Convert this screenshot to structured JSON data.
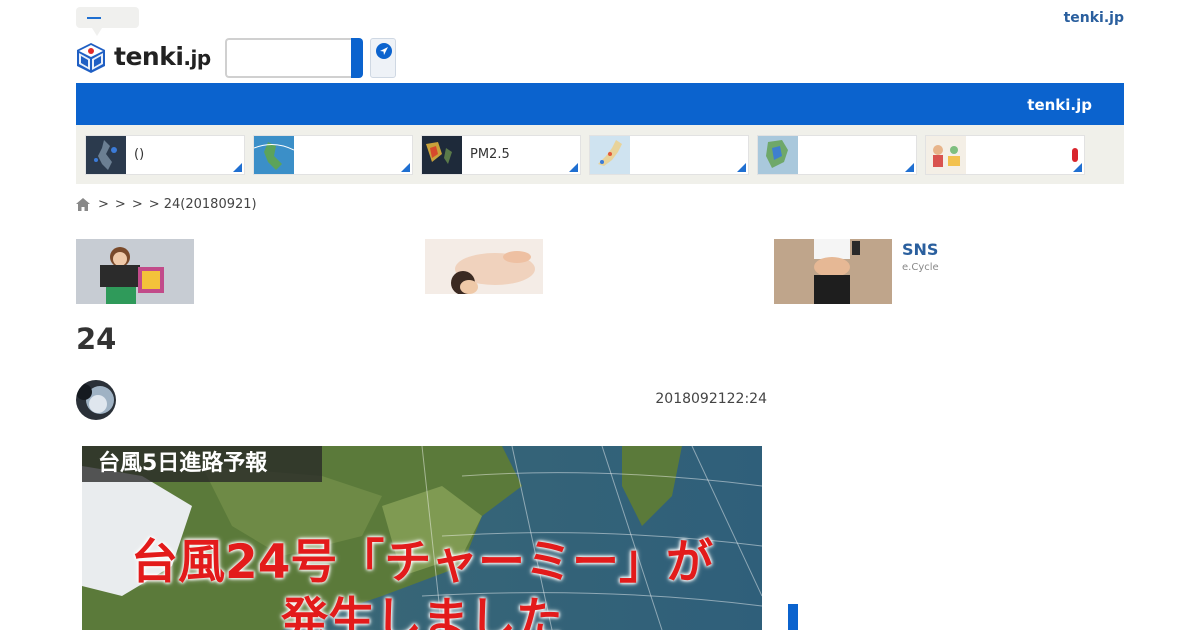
{
  "header": {
    "top_link": "tenki.jp",
    "logo_text": "tenki",
    "logo_tld": ".jp",
    "search": {
      "value": "",
      "placeholder": ""
    }
  },
  "navbar": {
    "label": "tenki.jp"
  },
  "tiles": [
    {
      "label": "()"
    },
    {
      "label": ""
    },
    {
      "label": "PM2.5"
    },
    {
      "label": ""
    },
    {
      "label": ""
    },
    {
      "label": ""
    }
  ],
  "breadcrumb": {
    "items": [
      ">",
      ">",
      ">",
      "> 24(20180921)"
    ]
  },
  "promo": {
    "sns_title": "SNS",
    "sns_source": "e.Cycle"
  },
  "article": {
    "title": "24",
    "timestamp": "2018092122:24",
    "hero_label": "台風5日進路予報",
    "hero_headline_1": "台風24号「チャーミー」が",
    "hero_headline_2": "発生しました"
  },
  "colors": {
    "brand_blue": "#0b63ce",
    "link_blue": "#2a5f9e",
    "alert_red": "#d9252d",
    "headline_red": "#e31b1b"
  }
}
